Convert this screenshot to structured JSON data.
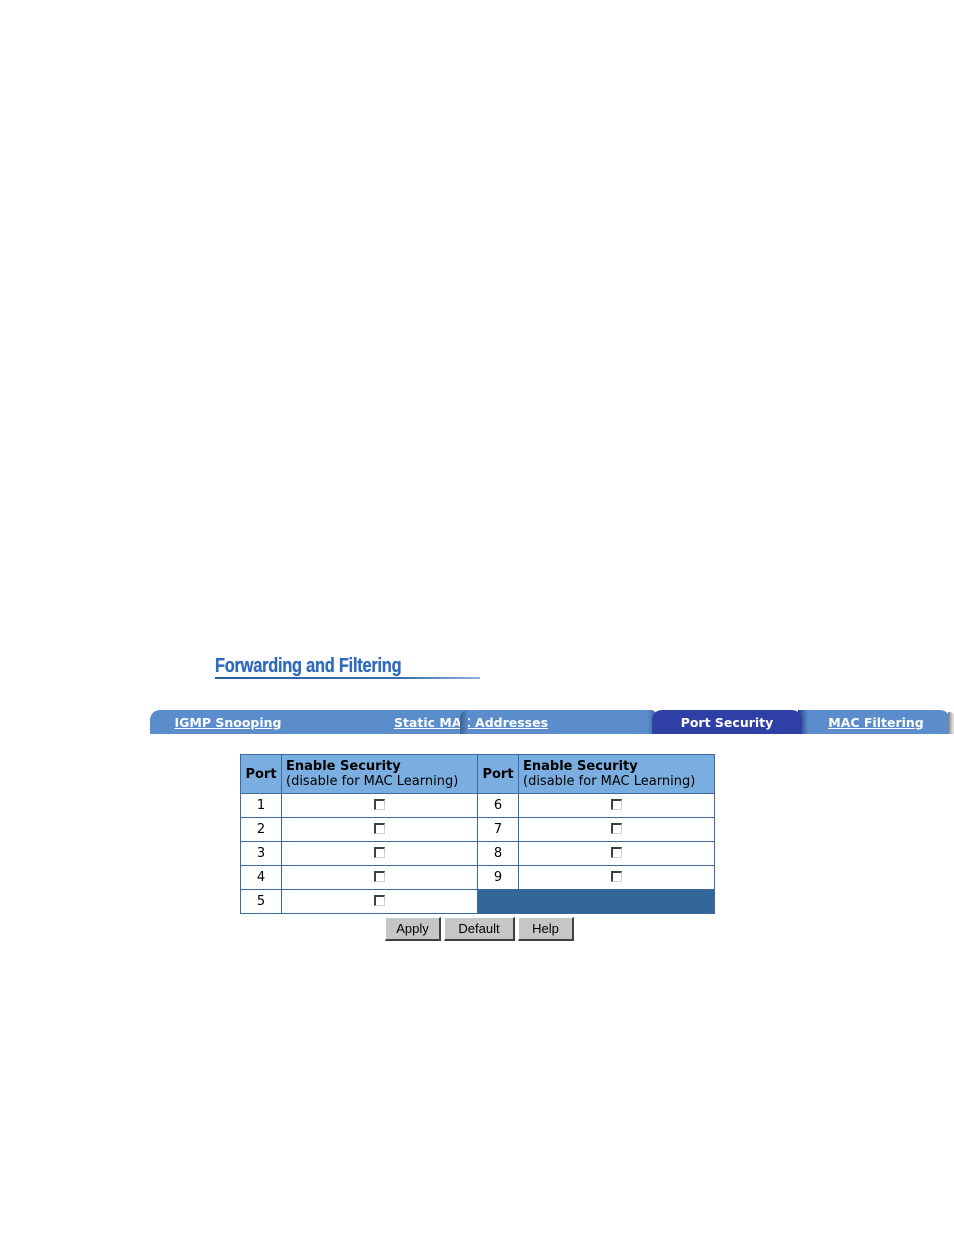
{
  "page": {
    "title": "Forwarding and Filtering"
  },
  "tabs": [
    {
      "label": "IGMP Snooping",
      "active": false
    },
    {
      "label": "Static MAC Addresses",
      "active": false
    },
    {
      "label": "Port Security",
      "active": true
    },
    {
      "label": "MAC Filtering",
      "active": false
    }
  ],
  "table": {
    "headers": {
      "port": "Port",
      "enable_title": "Enable Security",
      "enable_sub": "(disable for MAC Learning)"
    },
    "left_rows": [
      {
        "port": "1",
        "enabled": false
      },
      {
        "port": "2",
        "enabled": false
      },
      {
        "port": "3",
        "enabled": false
      },
      {
        "port": "4",
        "enabled": false
      },
      {
        "port": "5",
        "enabled": false
      }
    ],
    "right_rows": [
      {
        "port": "6",
        "enabled": false
      },
      {
        "port": "7",
        "enabled": false
      },
      {
        "port": "8",
        "enabled": false
      },
      {
        "port": "9",
        "enabled": false
      }
    ]
  },
  "buttons": {
    "apply": "Apply",
    "default": "Default",
    "help": "Help"
  },
  "colors": {
    "header_bg": "#7aaee0",
    "tab_bg": "#5b8ccb",
    "tab_active_bg": "#2e3fa6",
    "fill_cell": "#336699",
    "title": "#2e6bbf"
  }
}
